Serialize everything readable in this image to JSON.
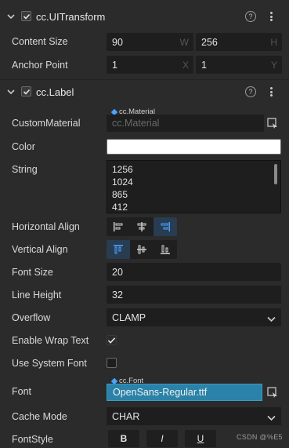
{
  "uitransform": {
    "title": "cc.UITransform",
    "content_size": {
      "label": "Content Size",
      "w_value": "90",
      "w_axis": "W",
      "h_value": "256",
      "h_axis": "H"
    },
    "anchor_point": {
      "label": "Anchor Point",
      "x_value": "1",
      "x_axis": "X",
      "y_value": "1",
      "y_axis": "Y"
    }
  },
  "label_component": {
    "title": "cc.Label",
    "custom_material": {
      "label": "CustomMaterial",
      "asset_type": "cc.Material",
      "placeholder": "cc.Material"
    },
    "color": {
      "label": "Color",
      "value": "#ffffff"
    },
    "string": {
      "label": "String",
      "lines": [
        "1256",
        "1024",
        "865",
        "412"
      ]
    },
    "horizontal_align": {
      "label": "Horizontal Align",
      "selected": "right"
    },
    "vertical_align": {
      "label": "Vertical Align",
      "selected": "top"
    },
    "font_size": {
      "label": "Font Size",
      "value": "20"
    },
    "line_height": {
      "label": "Line Height",
      "value": "32"
    },
    "overflow": {
      "label": "Overflow",
      "value": "CLAMP"
    },
    "enable_wrap_text": {
      "label": "Enable Wrap Text",
      "checked": true
    },
    "use_system_font": {
      "label": "Use System Font",
      "checked": false
    },
    "font": {
      "label": "Font",
      "asset_type": "cc.Font",
      "value": "OpenSans-Regular.ttf"
    },
    "cache_mode": {
      "label": "Cache Mode",
      "value": "CHAR"
    },
    "font_style": {
      "label": "FontStyle",
      "bold": "B",
      "italic": "I",
      "underline": "U"
    }
  },
  "icons": {
    "help": "?"
  },
  "watermark": "CSDN @%E5",
  "colors": {
    "background": "#2b2b2b",
    "field": "#1e1e1e",
    "accent": "#4aa3ff",
    "font_field": "#2a82a8",
    "active_segment": "#283c52"
  }
}
